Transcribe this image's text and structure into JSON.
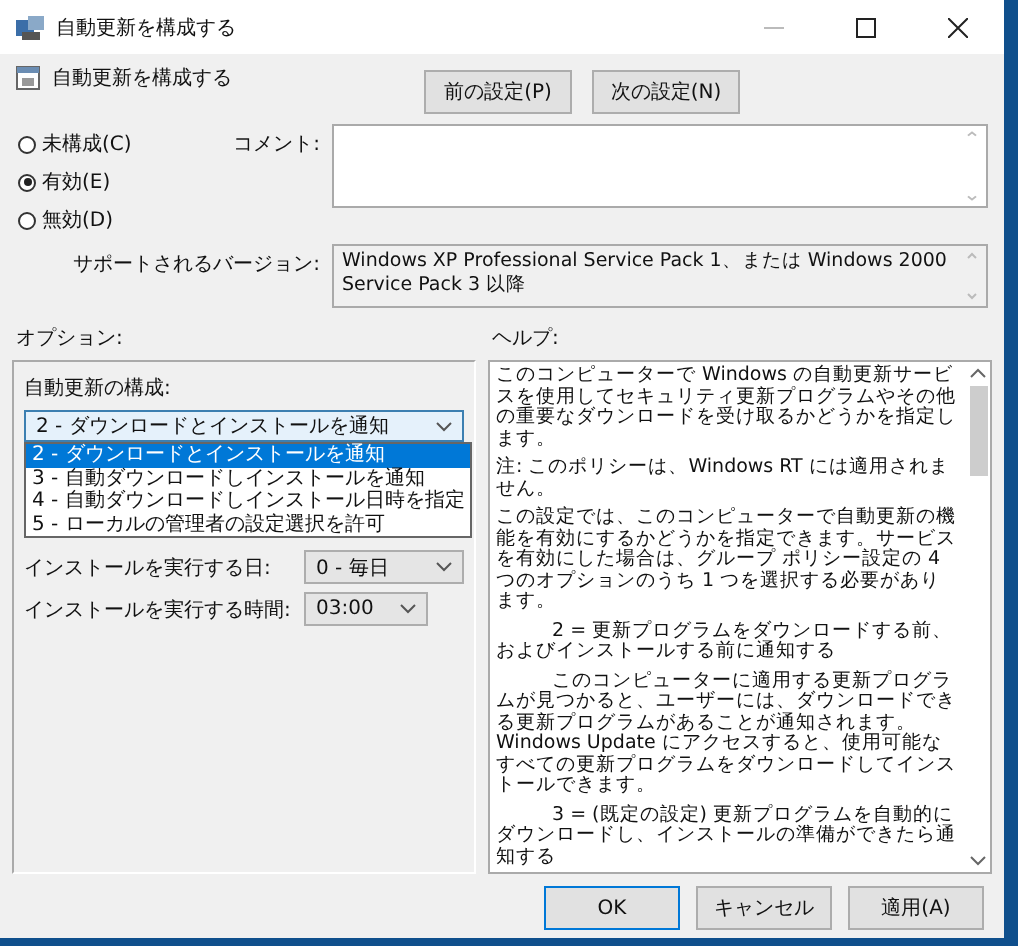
{
  "window": {
    "title": "自動更新を構成する"
  },
  "header": {
    "title": "自動更新を構成する",
    "buttons": [
      {
        "label": "前の設定(P)"
      },
      {
        "label": "次の設定(N)"
      }
    ]
  },
  "state_options": [
    {
      "label": "未構成(C)",
      "selected": false
    },
    {
      "label": "有効(E)",
      "selected": true
    },
    {
      "label": "無効(D)",
      "selected": false
    }
  ],
  "comment": {
    "label": "コメント:"
  },
  "supported": {
    "label": "サポートされるバージョン:",
    "value": "Windows XP Professional Service Pack 1、または Windows 2000 Service Pack 3 以降"
  },
  "options": {
    "label": "オプション:",
    "config_label": "自動更新の構成:",
    "config_select": {
      "value": "2 - ダウンロードとインストールを通知",
      "expanded": true,
      "items": [
        {
          "label": "2 - ダウンロードとインストールを通知",
          "selected": true
        },
        {
          "label": "3 - 自動ダウンロードしインストールを通知",
          "selected": false
        },
        {
          "label": "4 - 自動ダウンロードしインストール日時を指定",
          "selected": false
        },
        {
          "label": "5 - ローカルの管理者の設定選択を許可",
          "selected": false
        }
      ]
    },
    "fields": [
      {
        "label": "インストールを実行する日:",
        "value": "0 - 毎日"
      },
      {
        "label": "インストールを実行する時間:",
        "value": "03:00"
      }
    ]
  },
  "help": {
    "label": "ヘルプ:",
    "paragraphs": [
      {
        "text": "このコンピューターで Windows の自動更新サービスを使用してセキュリティ更新プログラムやその他の重要なダウンロードを受け取るかどうかを指定します。",
        "indent": false
      },
      {
        "text": "注: このポリシーは、Windows RT には適用されません。",
        "indent": false
      },
      {
        "text": "この設定では、このコンピューターで自動更新の機能を有効にするかどうかを指定できます。サービスを有効にした場合は、グループ ポリシー設定の 4 つのオプションのうち 1 つを選択する必要があります。",
        "indent": false
      },
      {
        "text": "2 = 更新プログラムをダウンロードする前、およびインストールする前に通知する",
        "indent": true
      },
      {
        "text": "このコンピューターに適用する更新プログラムが見つかると、ユーザーには、ダウンロードできる更新プログラムがあることが通知されます。Windows Update にアクセスすると、使用可能なすべての更新プログラムをダウンロードしてインストールできます。",
        "indent": true
      },
      {
        "text": "3 = (既定の設定) 更新プログラムを自動的にダウンロードし、インストールの準備ができたら通知する",
        "indent": true
      }
    ]
  },
  "buttons": [
    {
      "label": "OK",
      "default": true
    },
    {
      "label": "キャンセル",
      "default": false
    },
    {
      "label": "適用(A)",
      "default": false
    }
  ]
}
